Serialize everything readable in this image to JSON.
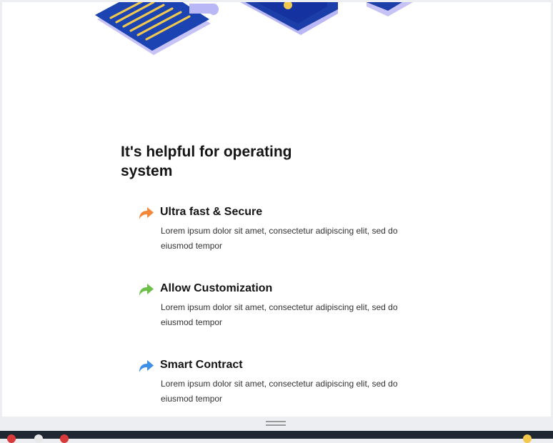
{
  "section": {
    "title": "It's helpful for operating system"
  },
  "features": [
    {
      "title": "Ultra fast & Secure",
      "description": "Lorem ipsum dolor sit amet, consectetur adipiscing elit, sed do eiusmod tempor",
      "icon": "arrow-forward-icon",
      "color": "#f4873a"
    },
    {
      "title": "Allow Customization",
      "description": "Lorem ipsum dolor sit amet, consectetur adipiscing elit, sed do eiusmod tempor",
      "icon": "arrow-forward-icon",
      "color": "#6cc04a"
    },
    {
      "title": "Smart Contract",
      "description": "Lorem ipsum dolor sit amet, consectetur adipiscing elit, sed do eiusmod tempor",
      "icon": "arrow-forward-icon",
      "color": "#3d8fe8"
    }
  ],
  "colors": {
    "illustration_primary": "#1a3fa8",
    "illustration_accent": "#f2c94c",
    "illustration_light": "#b9b7f5",
    "taskbar": "#1f2733"
  }
}
